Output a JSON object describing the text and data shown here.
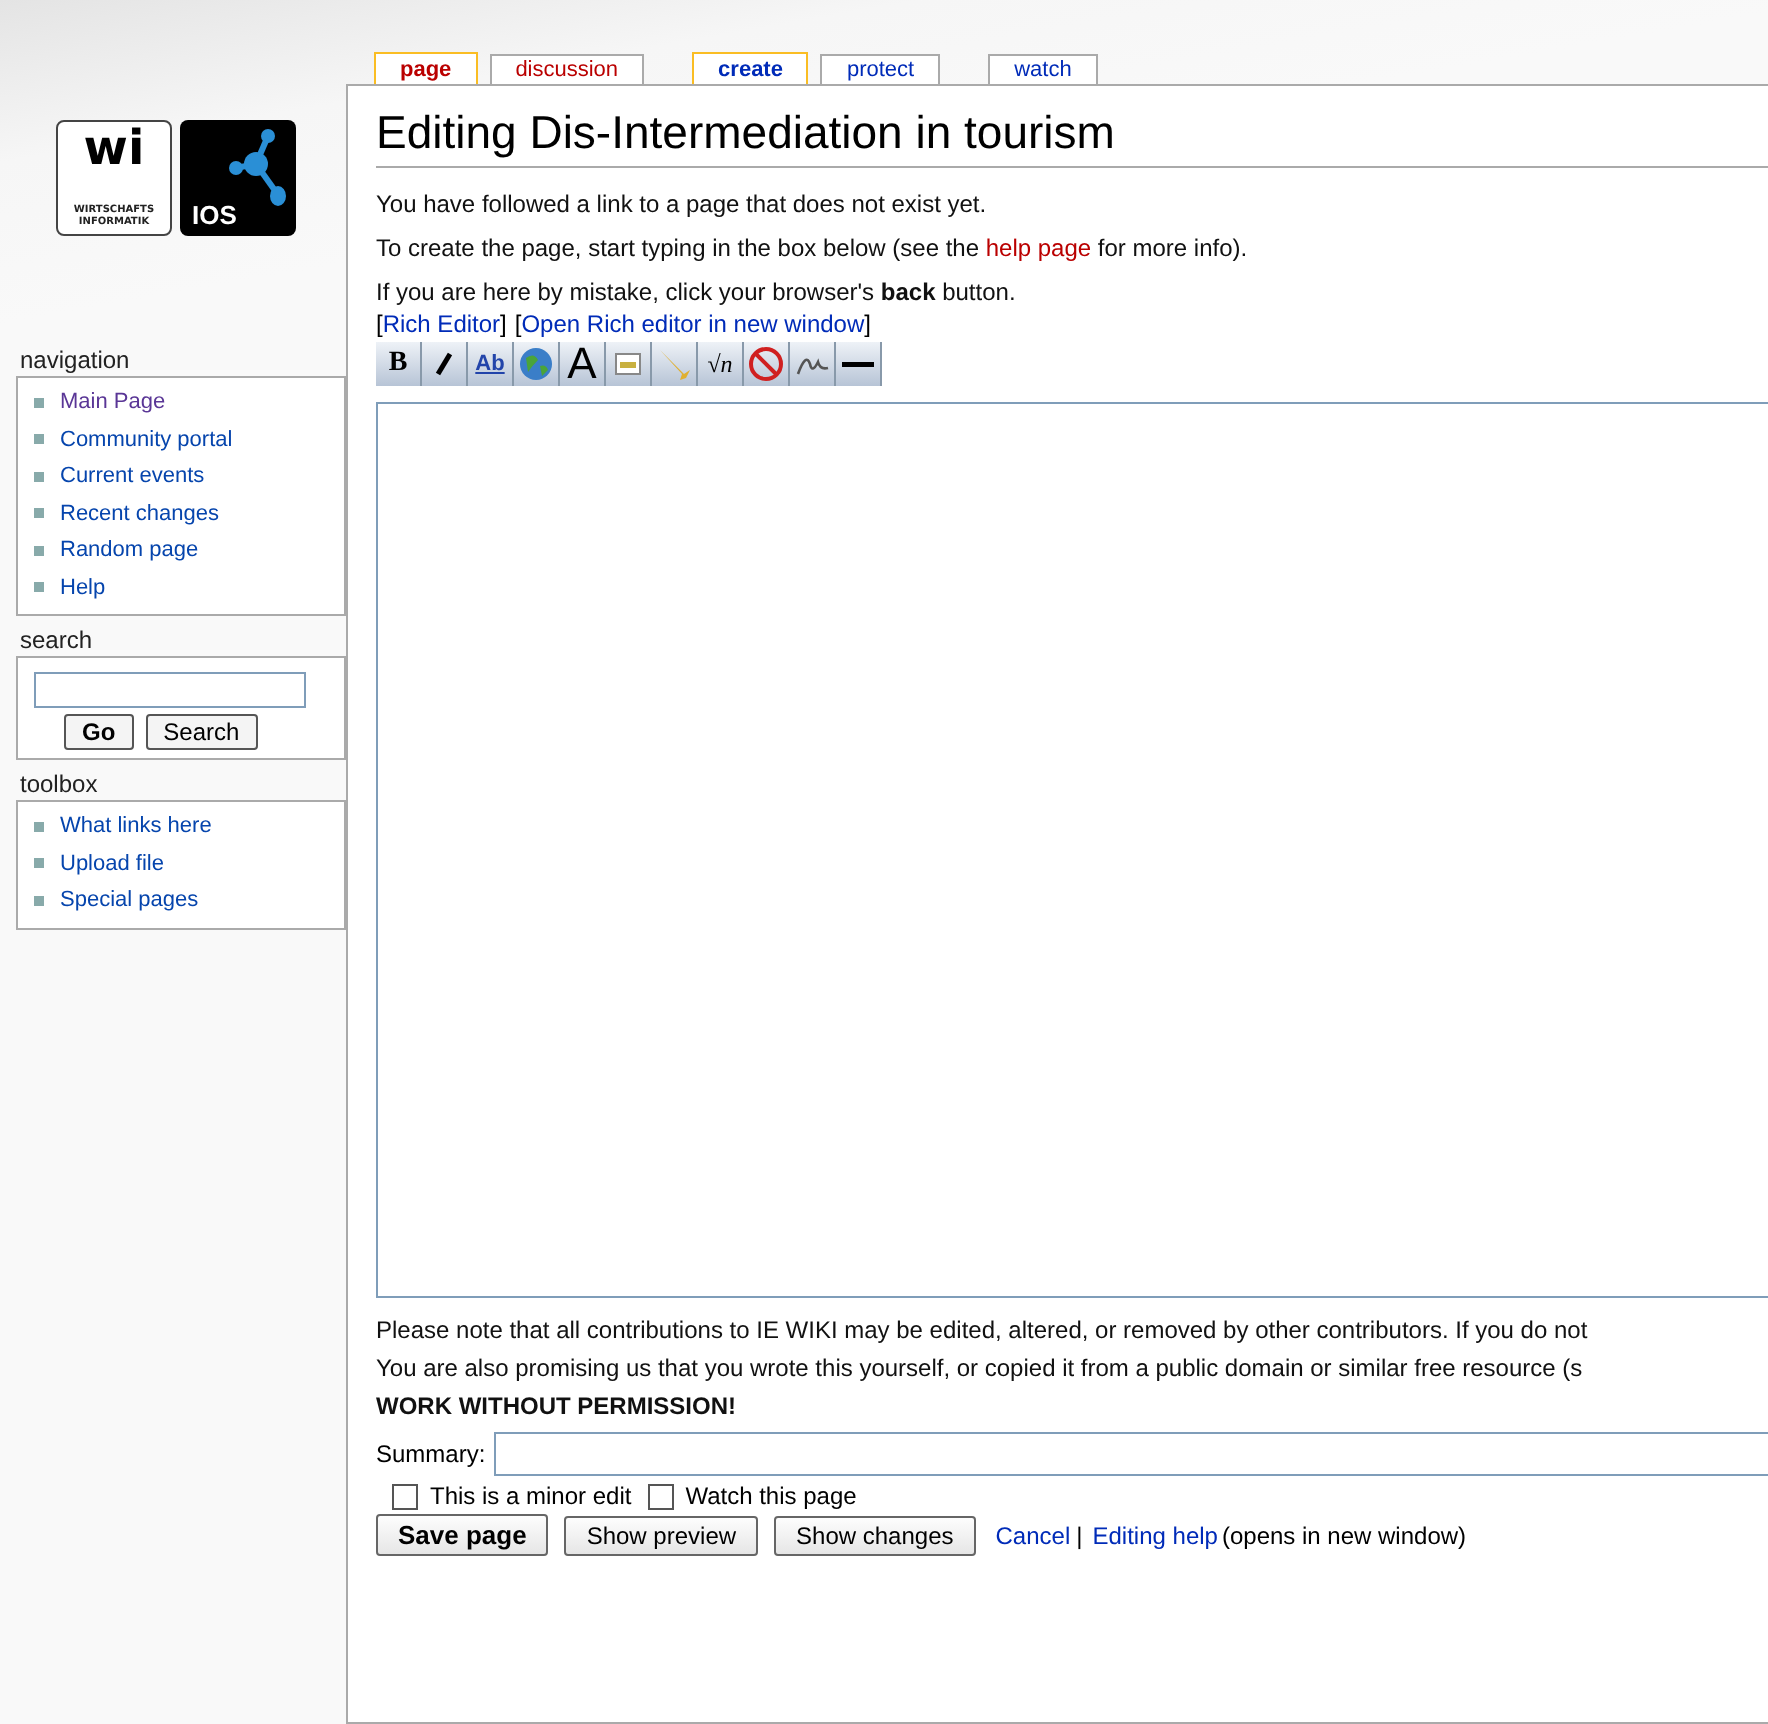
{
  "logo": {
    "mark": "wi",
    "caption": [
      "WIRTSCHAFTS",
      "INFORMATIK"
    ],
    "badge": "IOS"
  },
  "tabs": [
    {
      "label": "page",
      "selected": true,
      "missing": true
    },
    {
      "label": "discussion",
      "selected": false,
      "missing": true
    },
    {
      "label": "create",
      "selected": true,
      "missing": false
    },
    {
      "label": "protect",
      "selected": false,
      "missing": false
    },
    {
      "label": "watch",
      "selected": false,
      "missing": false
    }
  ],
  "sidebar": {
    "portlets": [
      {
        "title": "navigation",
        "items": [
          {
            "label": "Main Page",
            "visited": true
          },
          {
            "label": "Community portal",
            "visited": false
          },
          {
            "label": "Current events",
            "visited": false
          },
          {
            "label": "Recent changes",
            "visited": false
          },
          {
            "label": "Random page",
            "visited": false
          },
          {
            "label": "Help",
            "visited": false
          }
        ]
      },
      {
        "title": "search",
        "kind": "search",
        "buttons": [
          "Go",
          "Search"
        ]
      },
      {
        "title": "toolbox",
        "items": [
          {
            "label": "What links here",
            "visited": false
          },
          {
            "label": "Upload file",
            "visited": false
          },
          {
            "label": "Special pages",
            "visited": false
          }
        ]
      }
    ]
  },
  "title": "Editing Dis-Intermediation in tourism",
  "intro": [
    {
      "text": "You have followed a link to a page that does not exist yet."
    },
    {
      "before": "To create the page, start typing in the box below (see the ",
      "link": "help page",
      "after": " for more info)."
    },
    {
      "text": "If you are here by mistake, click your browser's **back** button."
    }
  ],
  "editor_links": [
    {
      "open": "[",
      "label": "Rich Editor",
      "close": "]"
    },
    {
      "open": "[",
      "label": "Open Rich editor in new window",
      "close": "]"
    }
  ],
  "toolbar": [
    {
      "kind": "bold",
      "glyph": "B"
    },
    {
      "kind": "italic"
    },
    {
      "kind": "link",
      "glyph": "Ab"
    },
    {
      "kind": "globe"
    },
    {
      "kind": "headline",
      "glyph": "A"
    },
    {
      "kind": "image"
    },
    {
      "kind": "media"
    },
    {
      "kind": "math",
      "glyph": "√n"
    },
    {
      "kind": "nowiki"
    },
    {
      "kind": "signature"
    },
    {
      "kind": "hr"
    }
  ],
  "notice": [
    "Please note that all contributions to IE WIKI may be edited, altered, or removed by other contributors. If you do not",
    "You are also promising us that you wrote this yourself, or copied it from a public domain or similar free resource (s"
  ],
  "warning": "WORK WITHOUT PERMISSION!",
  "summary_label": "Summary:",
  "options": [
    {
      "label": "This is a minor edit",
      "checked": false
    },
    {
      "label": "Watch this page",
      "checked": false
    }
  ],
  "buttons": [
    {
      "label": "Save page",
      "primary": true
    },
    {
      "label": "Show preview",
      "primary": false
    },
    {
      "label": "Show changes",
      "primary": false
    }
  ],
  "cancel": "Cancel",
  "separator": "|",
  "help_link": "Editing help",
  "help_note": "(opens in new window)"
}
